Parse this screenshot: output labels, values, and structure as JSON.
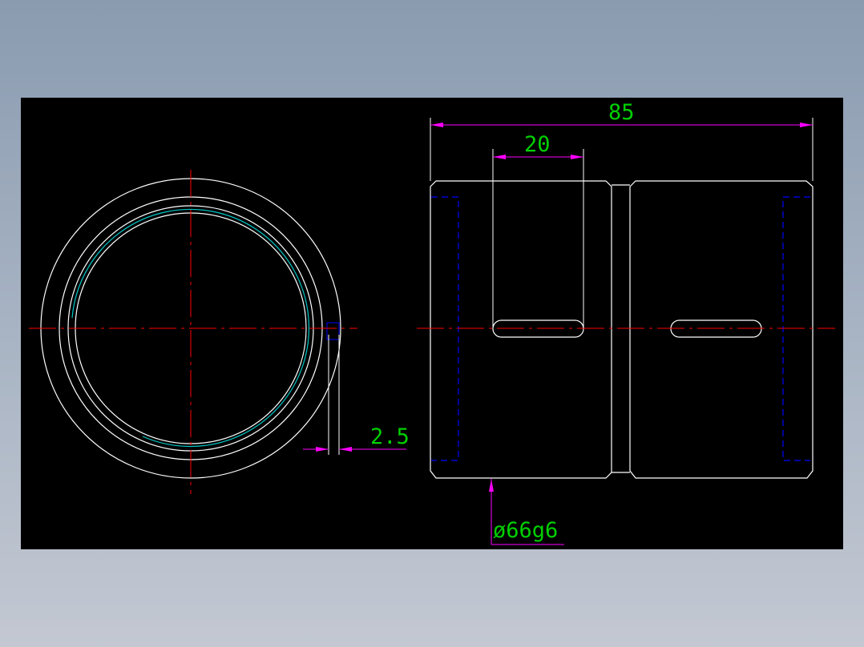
{
  "colors": {
    "background_top": "#8a9bb0",
    "background_bottom": "#c3c8d2",
    "canvas": "#000000",
    "outline": "#ffffff",
    "center_line": "#ff0000",
    "dimension_line": "#ff00ff",
    "dimension_text": "#00d000",
    "hidden_line": "#0000ff",
    "thread_arc": "#00c8c8"
  },
  "dimensions": {
    "overall_length": "85",
    "slot_width": "20",
    "groove_depth": "2.5",
    "outer_diameter": "ø66g6"
  }
}
